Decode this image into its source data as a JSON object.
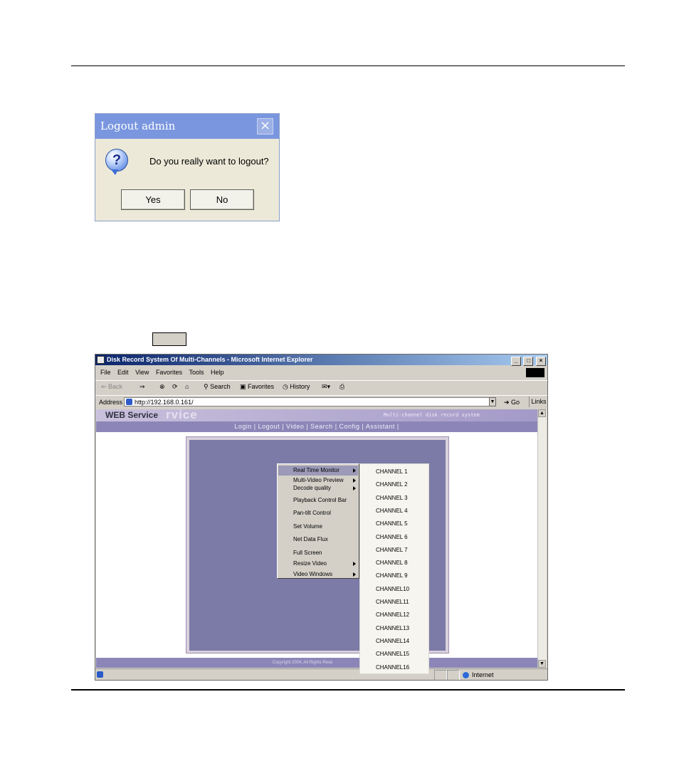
{
  "dialog": {
    "title": "Logout admin",
    "close_glyph": "×",
    "icon": "question-icon",
    "message": "Do you really want to logout?",
    "yes_label": "Yes",
    "no_label": "No"
  },
  "browser": {
    "title": "Disk Record System Of Multi-Channels - Microsoft Internet Explorer",
    "window_buttons": [
      "_",
      "□",
      "×"
    ],
    "menu": [
      "File",
      "Edit",
      "View",
      "Favorites",
      "Tools",
      "Help"
    ],
    "toolbar": {
      "back": "⇐ Back",
      "forward": "⇒",
      "search": "Search",
      "favorites": "Favorites",
      "history": "History"
    },
    "address_label": "Address",
    "address_value": "http://192.168.0.161/",
    "go_label": "Go",
    "links_label": "Links",
    "status_zone": "Internet"
  },
  "web_service": {
    "title": "WEB Service",
    "ghost_text": "rvice",
    "subtitle": "Multi-channel disk record system",
    "nav": "Login | Logout | Video | Search | Config | Assistant |",
    "footer": "Copyright 2004,  All Rights Rese"
  },
  "context_menu": {
    "items": [
      {
        "label": "Real Time Monitor",
        "submenu": true,
        "selected": true
      },
      {
        "label": "Multi-Video Preview",
        "submenu": true
      },
      {
        "label": "Decode quality",
        "submenu": true
      },
      {
        "label": "Playback Control Bar",
        "submenu": false
      },
      {
        "label": "Pan-tilt Control",
        "submenu": false
      },
      {
        "label": "Set Volume",
        "submenu": false
      },
      {
        "label": "Net Data Flux",
        "submenu": false
      },
      {
        "label": "Full Screen",
        "submenu": false
      },
      {
        "label": "Resize Video",
        "submenu": true
      },
      {
        "label": "Video Windows",
        "submenu": true
      }
    ],
    "channels": [
      "CHANNEL 1",
      "CHANNEL 2",
      "CHANNEL 3",
      "CHANNEL 4",
      "CHANNEL 5",
      "CHANNEL 6",
      "CHANNEL 7",
      "CHANNEL 8",
      "CHANNEL 9",
      "CHANNEL10",
      "CHANNEL11",
      "CHANNEL12",
      "CHANNEL13",
      "CHANNEL14",
      "CHANNEL15",
      "CHANNEL16"
    ]
  }
}
